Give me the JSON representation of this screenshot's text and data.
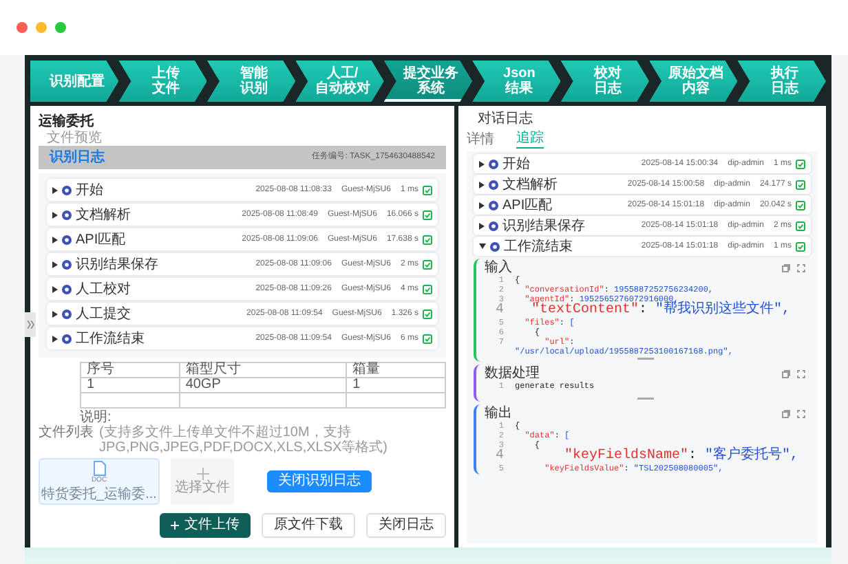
{
  "steps": [
    {
      "lines": [
        "识别配置"
      ],
      "selected": false
    },
    {
      "lines": [
        "上传",
        "文件"
      ],
      "selected": false
    },
    {
      "lines": [
        "智能",
        "识别"
      ],
      "selected": false
    },
    {
      "lines": [
        "人工/",
        "自动校对"
      ],
      "selected": false
    },
    {
      "lines": [
        "提交业务",
        "系统"
      ],
      "selected": true
    },
    {
      "lines": [
        "Json",
        "结果"
      ],
      "selected": false
    },
    {
      "lines": [
        "校对",
        "日志"
      ],
      "selected": false
    },
    {
      "lines": [
        "原始文档",
        "内容"
      ],
      "selected": false
    },
    {
      "lines": [
        "执行",
        "日志"
      ],
      "selected": false
    }
  ],
  "task_panel": {
    "title": "运输委托",
    "preview_label": "文件预览",
    "log_tab": "识别日志",
    "task_id": "任务编号: TASK_1754630488542",
    "log_rows": [
      {
        "name": "开始",
        "time": "2025-08-08 11:08:33",
        "user": "Guest-MjSU6",
        "duration": "1 ms",
        "expanded": false
      },
      {
        "name": "文档解析",
        "time": "2025-08-08 11:08:49",
        "user": "Guest-MjSU6",
        "duration": "16.066 s",
        "expanded": false
      },
      {
        "name": "API匹配",
        "time": "2025-08-08 11:09:06",
        "user": "Guest-MjSU6",
        "duration": "17.638 s",
        "expanded": false
      },
      {
        "name": "识别结果保存",
        "time": "2025-08-08 11:09:06",
        "user": "Guest-MjSU6",
        "duration": "2 ms",
        "expanded": false
      },
      {
        "name": "人工校对",
        "time": "2025-08-08 11:09:26",
        "user": "Guest-MjSU6",
        "duration": "4 ms",
        "expanded": false
      },
      {
        "name": "人工提交",
        "time": "2025-08-08 11:09:54",
        "user": "Guest-MjSU6",
        "duration": "1.326 s",
        "expanded": false
      },
      {
        "name": "工作流结束",
        "time": "2025-08-08 11:09:54",
        "user": "Guest-MjSU6",
        "duration": "6 ms",
        "expanded": false
      }
    ],
    "table": {
      "columns": [
        "序号",
        "箱型尺寸",
        "箱量"
      ],
      "rows": [
        [
          "1",
          "40GP",
          "1"
        ]
      ]
    },
    "note_label": "说明:",
    "file_list_title": "文件列表",
    "file_list_hint": "(支持多文件上传单文件不超过10M，支持JPG,PNG,JPEG,PDF,DOCX,XLS,XLSX等格式)",
    "files": [
      {
        "type": "DOC",
        "name": "特货委托_运输委..."
      }
    ],
    "add_file": "选择文件",
    "close_log_button": "关闭识别日志",
    "actions": [
      {
        "label": "文件上传",
        "kind": "primary"
      },
      {
        "label": "原文件下载",
        "kind": "outline"
      },
      {
        "label": "关闭日志",
        "kind": "outline"
      }
    ]
  },
  "dialog_log": {
    "title": "对话日志",
    "tabs": [
      {
        "label": "详情",
        "selected": false
      },
      {
        "label": "追踪",
        "selected": true
      }
    ],
    "trace_rows": [
      {
        "name": "开始",
        "time": "2025-08-14 15:00:34",
        "user": "dip-admin",
        "duration": "1 ms",
        "expanded": false
      },
      {
        "name": "文档解析",
        "time": "2025-08-14 15:00:58",
        "user": "dip-admin",
        "duration": "24.177 s",
        "expanded": false
      },
      {
        "name": "API匹配",
        "time": "2025-08-14 15:01:18",
        "user": "dip-admin",
        "duration": "20.042 s",
        "expanded": false
      },
      {
        "name": "识别结果保存",
        "time": "2025-08-14 15:01:18",
        "user": "dip-admin",
        "duration": "2 ms",
        "expanded": false
      },
      {
        "name": "工作流结束",
        "time": "2025-08-14 15:01:18",
        "user": "dip-admin",
        "duration": "1 ms",
        "expanded": true
      }
    ],
    "sections": [
      {
        "title": "输入",
        "color": "#22c55e",
        "lines": [
          {
            "no": "1",
            "text": "{"
          },
          {
            "no": "2",
            "text": "  \"conversationId\": 1955887252756234200,"
          },
          {
            "no": "3",
            "text": "  \"agentId\": 1952565276072916000,"
          },
          {
            "no": "4",
            "text": "  \"textContent\": \"帮我识别这些文件\","
          },
          {
            "no": "5",
            "text": "  \"files\": ["
          },
          {
            "no": "6",
            "text": "    {"
          },
          {
            "no": "7",
            "text": "      \"url\":"
          },
          {
            "text": "\"/usr/local/upload/1955887253100167168.png\","
          }
        ]
      },
      {
        "title": "数据处理",
        "color": "#8b5cf6",
        "lines": [
          {
            "no": "1",
            "text": "generate results"
          }
        ]
      },
      {
        "title": "输出",
        "color": "#3b82f6",
        "lines": [
          {
            "no": "1",
            "text": "{"
          },
          {
            "no": "2",
            "text": "  \"data\": ["
          },
          {
            "no": "3",
            "text": "    {"
          },
          {
            "no": "4",
            "text": "      \"keyFieldsName\": \"客户委托号\","
          },
          {
            "no": "5",
            "text": "      \"keyFieldsValue\": \"TSL202508080005\","
          }
        ]
      }
    ]
  }
}
